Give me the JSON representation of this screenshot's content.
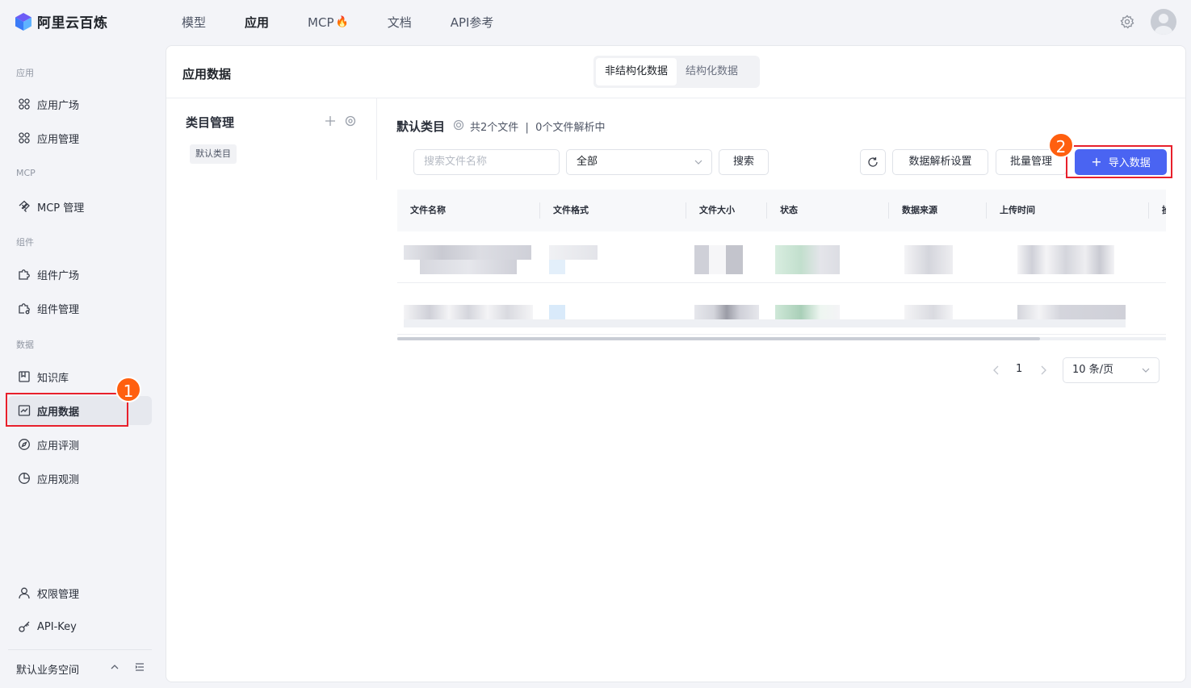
{
  "brand": {
    "name": "阿里云百炼"
  },
  "topnav": {
    "items": [
      {
        "label": "模型"
      },
      {
        "label": "应用"
      },
      {
        "label": "MCP"
      },
      {
        "label": "文档"
      },
      {
        "label": "API参考"
      }
    ],
    "active": "应用"
  },
  "sidebar": {
    "groups": {
      "app": "应用",
      "mcp": "MCP",
      "component": "组件",
      "data": "数据"
    },
    "items": {
      "app_plaza": "应用广场",
      "app_manage": "应用管理",
      "mcp_manage": "MCP 管理",
      "comp_plaza": "组件广场",
      "comp_manage": "组件管理",
      "knowledge": "知识库",
      "app_data": "应用数据",
      "app_eval": "应用评测",
      "app_observe": "应用观测",
      "permission": "权限管理",
      "api_key": "API-Key"
    },
    "active": "应用数据",
    "workspace": "默认业务空间"
  },
  "panel": {
    "title": "应用数据",
    "tabs": [
      {
        "label": "非结构化数据",
        "active": true
      },
      {
        "label": "结构化数据",
        "active": false
      }
    ]
  },
  "category": {
    "title": "类目管理",
    "tag": "默认类目"
  },
  "current": {
    "title": "默认类目",
    "meta": "共2个文件  |  0个文件解析中"
  },
  "toolbar": {
    "search_placeholder": "搜索文件名称",
    "filter_value": "全部",
    "search_label": "搜索",
    "parse_label": "数据解析设置",
    "batch_label": "批量管理",
    "import_label": "导入数据"
  },
  "table": {
    "columns": [
      "文件名称",
      "文件格式",
      "文件大小",
      "状态",
      "数据来源",
      "上传时间",
      "操"
    ],
    "row_count": 2
  },
  "pagination": {
    "page": "1",
    "page_size": "10 条/页"
  },
  "annotations": {
    "step1": "1",
    "step2": "2"
  },
  "colors": {
    "accent": "#4a64f2",
    "highlight": "#e8202c",
    "badge": "#ff5f0f"
  }
}
